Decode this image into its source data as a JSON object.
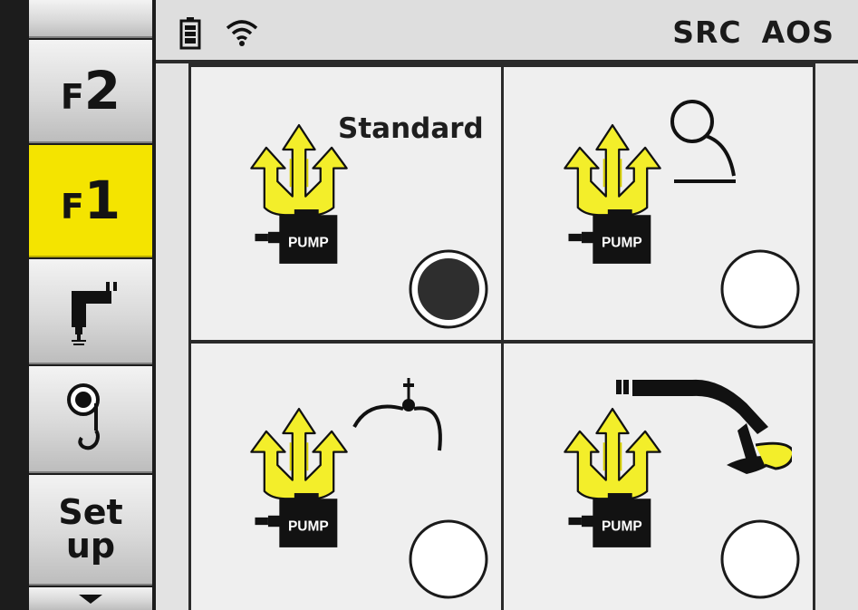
{
  "sidebar": {
    "f2": {
      "letter": "F",
      "number": "2"
    },
    "f1": {
      "letter": "F",
      "number": "1"
    },
    "setup": {
      "line1": "Set",
      "line2": "up"
    }
  },
  "statusbar": {
    "src": "SRC",
    "aos": "AOS"
  },
  "modes": [
    {
      "title": "Standard",
      "pump_label": "PUMP",
      "selected": true,
      "attachment_icon": "none"
    },
    {
      "title": "",
      "pump_label": "PUMP",
      "selected": false,
      "attachment_icon": "magnet-icon"
    },
    {
      "title": "",
      "pump_label": "PUMP",
      "selected": false,
      "attachment_icon": "grapple-icon"
    },
    {
      "title": "",
      "pump_label": "PUMP",
      "selected": false,
      "attachment_icon": "excavator-arm-icon"
    }
  ],
  "colors": {
    "accent_yellow": "#f4e400",
    "flow_arrow_yellow": "#f3ee2a",
    "background": "#1c1c1c",
    "panel": "#efefef"
  }
}
